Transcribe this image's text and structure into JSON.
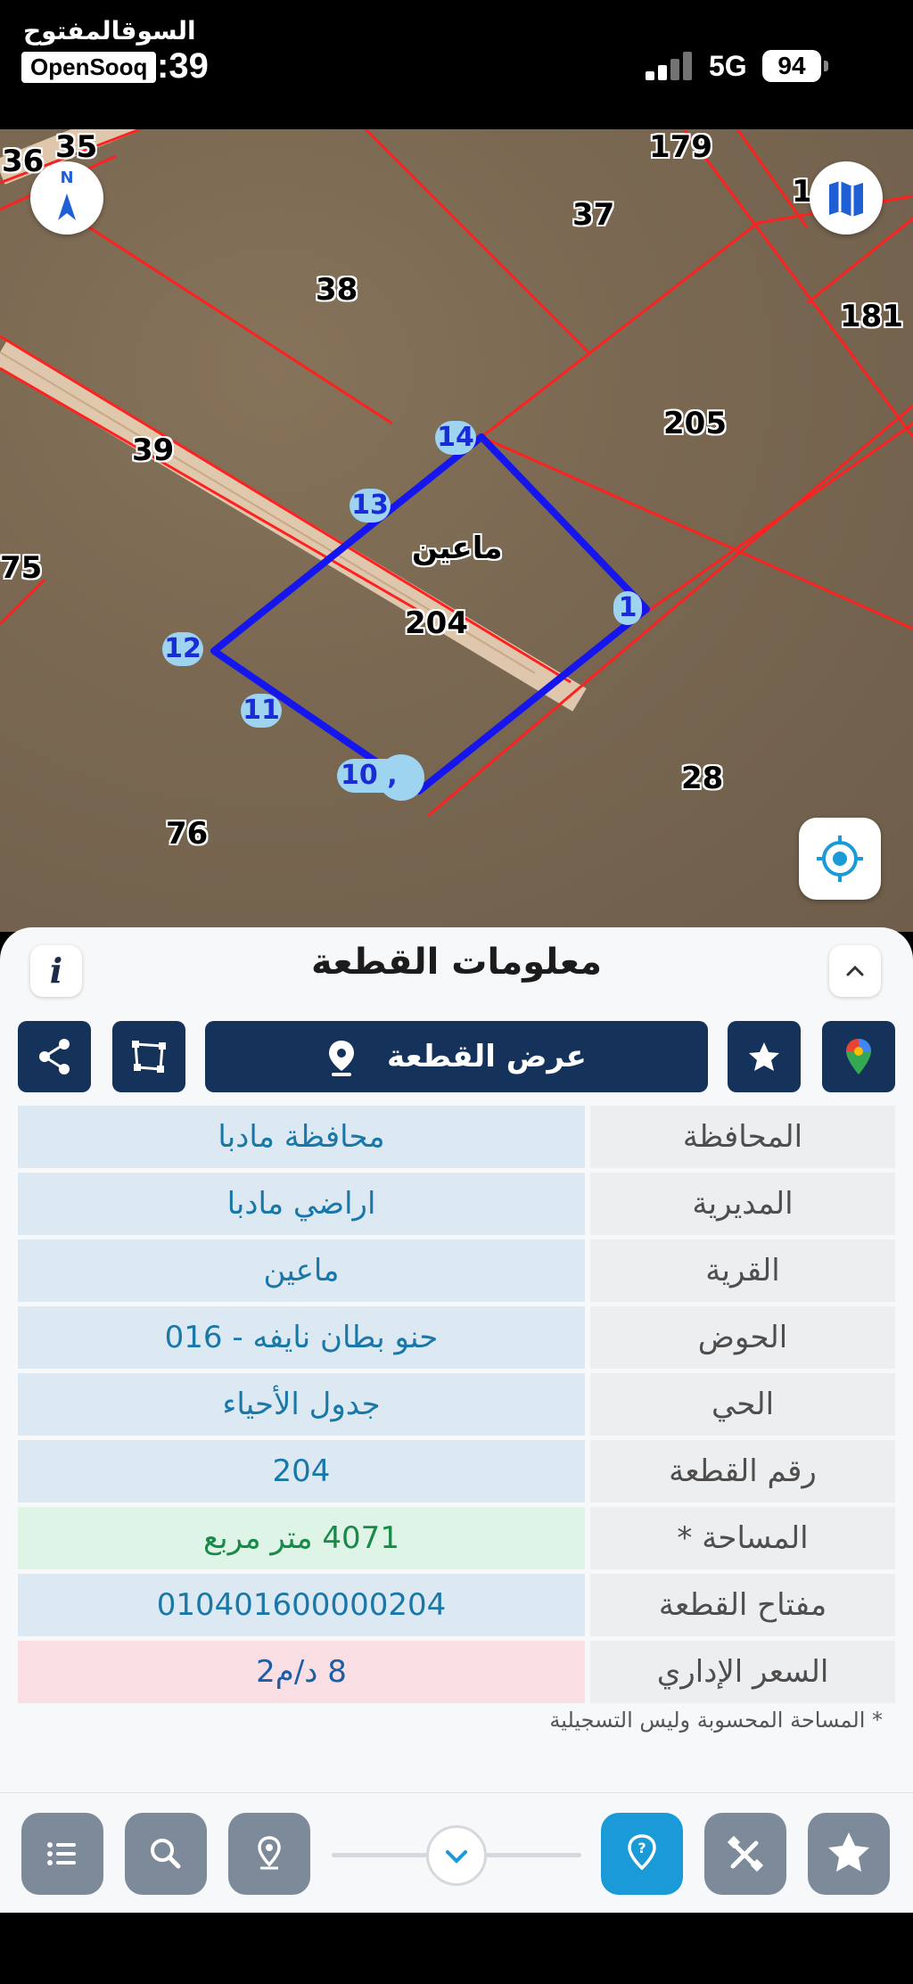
{
  "status_bar": {
    "watermark_ar": "السوقالمفتوح",
    "watermark_en": "OpenSooq",
    "time": ":39",
    "network": "5G",
    "battery": "94"
  },
  "map": {
    "plot_numbers": [
      "35",
      "36",
      "179",
      "1",
      "37",
      "181",
      "38",
      "205",
      "39",
      "75",
      "204",
      "28",
      "76"
    ],
    "village_label": "ماعين",
    "vertices": [
      "14",
      "13",
      "1",
      "12",
      "11",
      "10"
    ],
    "vertex_extra": ",",
    "north_label": "N",
    "colors": {
      "boundary": "#ff2020",
      "selected_plot": "#1515ee",
      "vertex_bg": "#9ed4ef"
    }
  },
  "panel": {
    "title": "معلومات القطعة",
    "info_icon": "i",
    "view_plot_label": "عرض القطعة",
    "rows": [
      {
        "label": "المحافظة",
        "value": "محافظة مادبا",
        "style": "blue"
      },
      {
        "label": "المديرية",
        "value": "اراضي مادبا",
        "style": "blue"
      },
      {
        "label": "القرية",
        "value": "ماعين",
        "style": "blue"
      },
      {
        "label": "الحوض",
        "value": "حنو بطان نايفه - 016",
        "style": "blue"
      },
      {
        "label": "الحي",
        "value": "جدول الأحياء",
        "style": "blue"
      },
      {
        "label": "رقم القطعة",
        "value": "204",
        "style": "blue"
      },
      {
        "label": "المساحة *",
        "value": "4071  متر مربع",
        "style": "green"
      },
      {
        "label": "مفتاح القطعة",
        "value": "010401600000204",
        "style": "blue"
      },
      {
        "label": "السعر الإداري",
        "value": "8 د/م2",
        "style": "pink"
      }
    ],
    "footnote": "* المساحة المحسوبة وليس التسجيلية"
  },
  "toolbar": {
    "icons": [
      "list-icon",
      "search-icon",
      "location-pin-icon",
      "chevron-down-icon",
      "pin-question-icon",
      "satellite-icon",
      "star-icon"
    ],
    "accent": "#1a9ad6"
  }
}
